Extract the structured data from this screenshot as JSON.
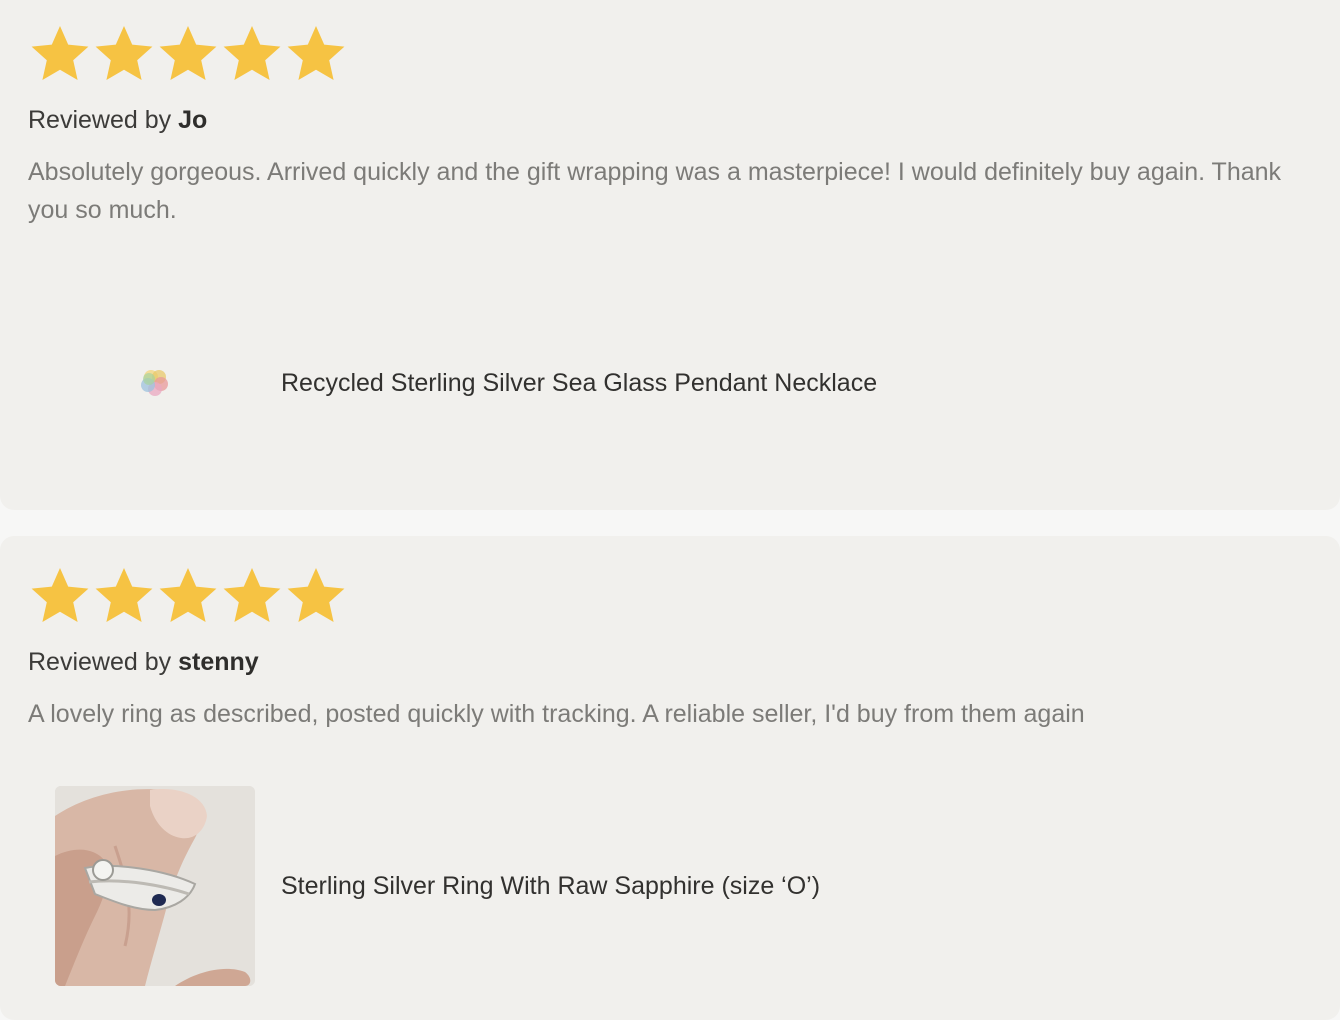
{
  "colors": {
    "star": "#f6c343",
    "card_background": "#f1f0ed",
    "reviewer_text": "#3c3b39",
    "body_text": "#7c7b78"
  },
  "reviews": [
    {
      "rating": 5,
      "rating_max": 5,
      "reviewed_by_label": "Reviewed by",
      "reviewer_name": "Jo",
      "text": "Absolutely gorgeous. Arrived quickly and the gift wrapping was a masterpiece! I would definitely buy again. Thank you so much.",
      "product": {
        "title": "Recycled Sterling Silver Sea Glass Pendant Necklace",
        "image": "loading-spinner-icon"
      }
    },
    {
      "rating": 5,
      "rating_max": 5,
      "reviewed_by_label": "Reviewed by",
      "reviewer_name": "stenny",
      "text": "A lovely ring as described, posted quickly with tracking. A reliable seller, I'd buy from them again",
      "product": {
        "title": "Sterling Silver Ring With Raw Sapphire (size ‘O’)",
        "image": "ring-photo"
      }
    }
  ]
}
